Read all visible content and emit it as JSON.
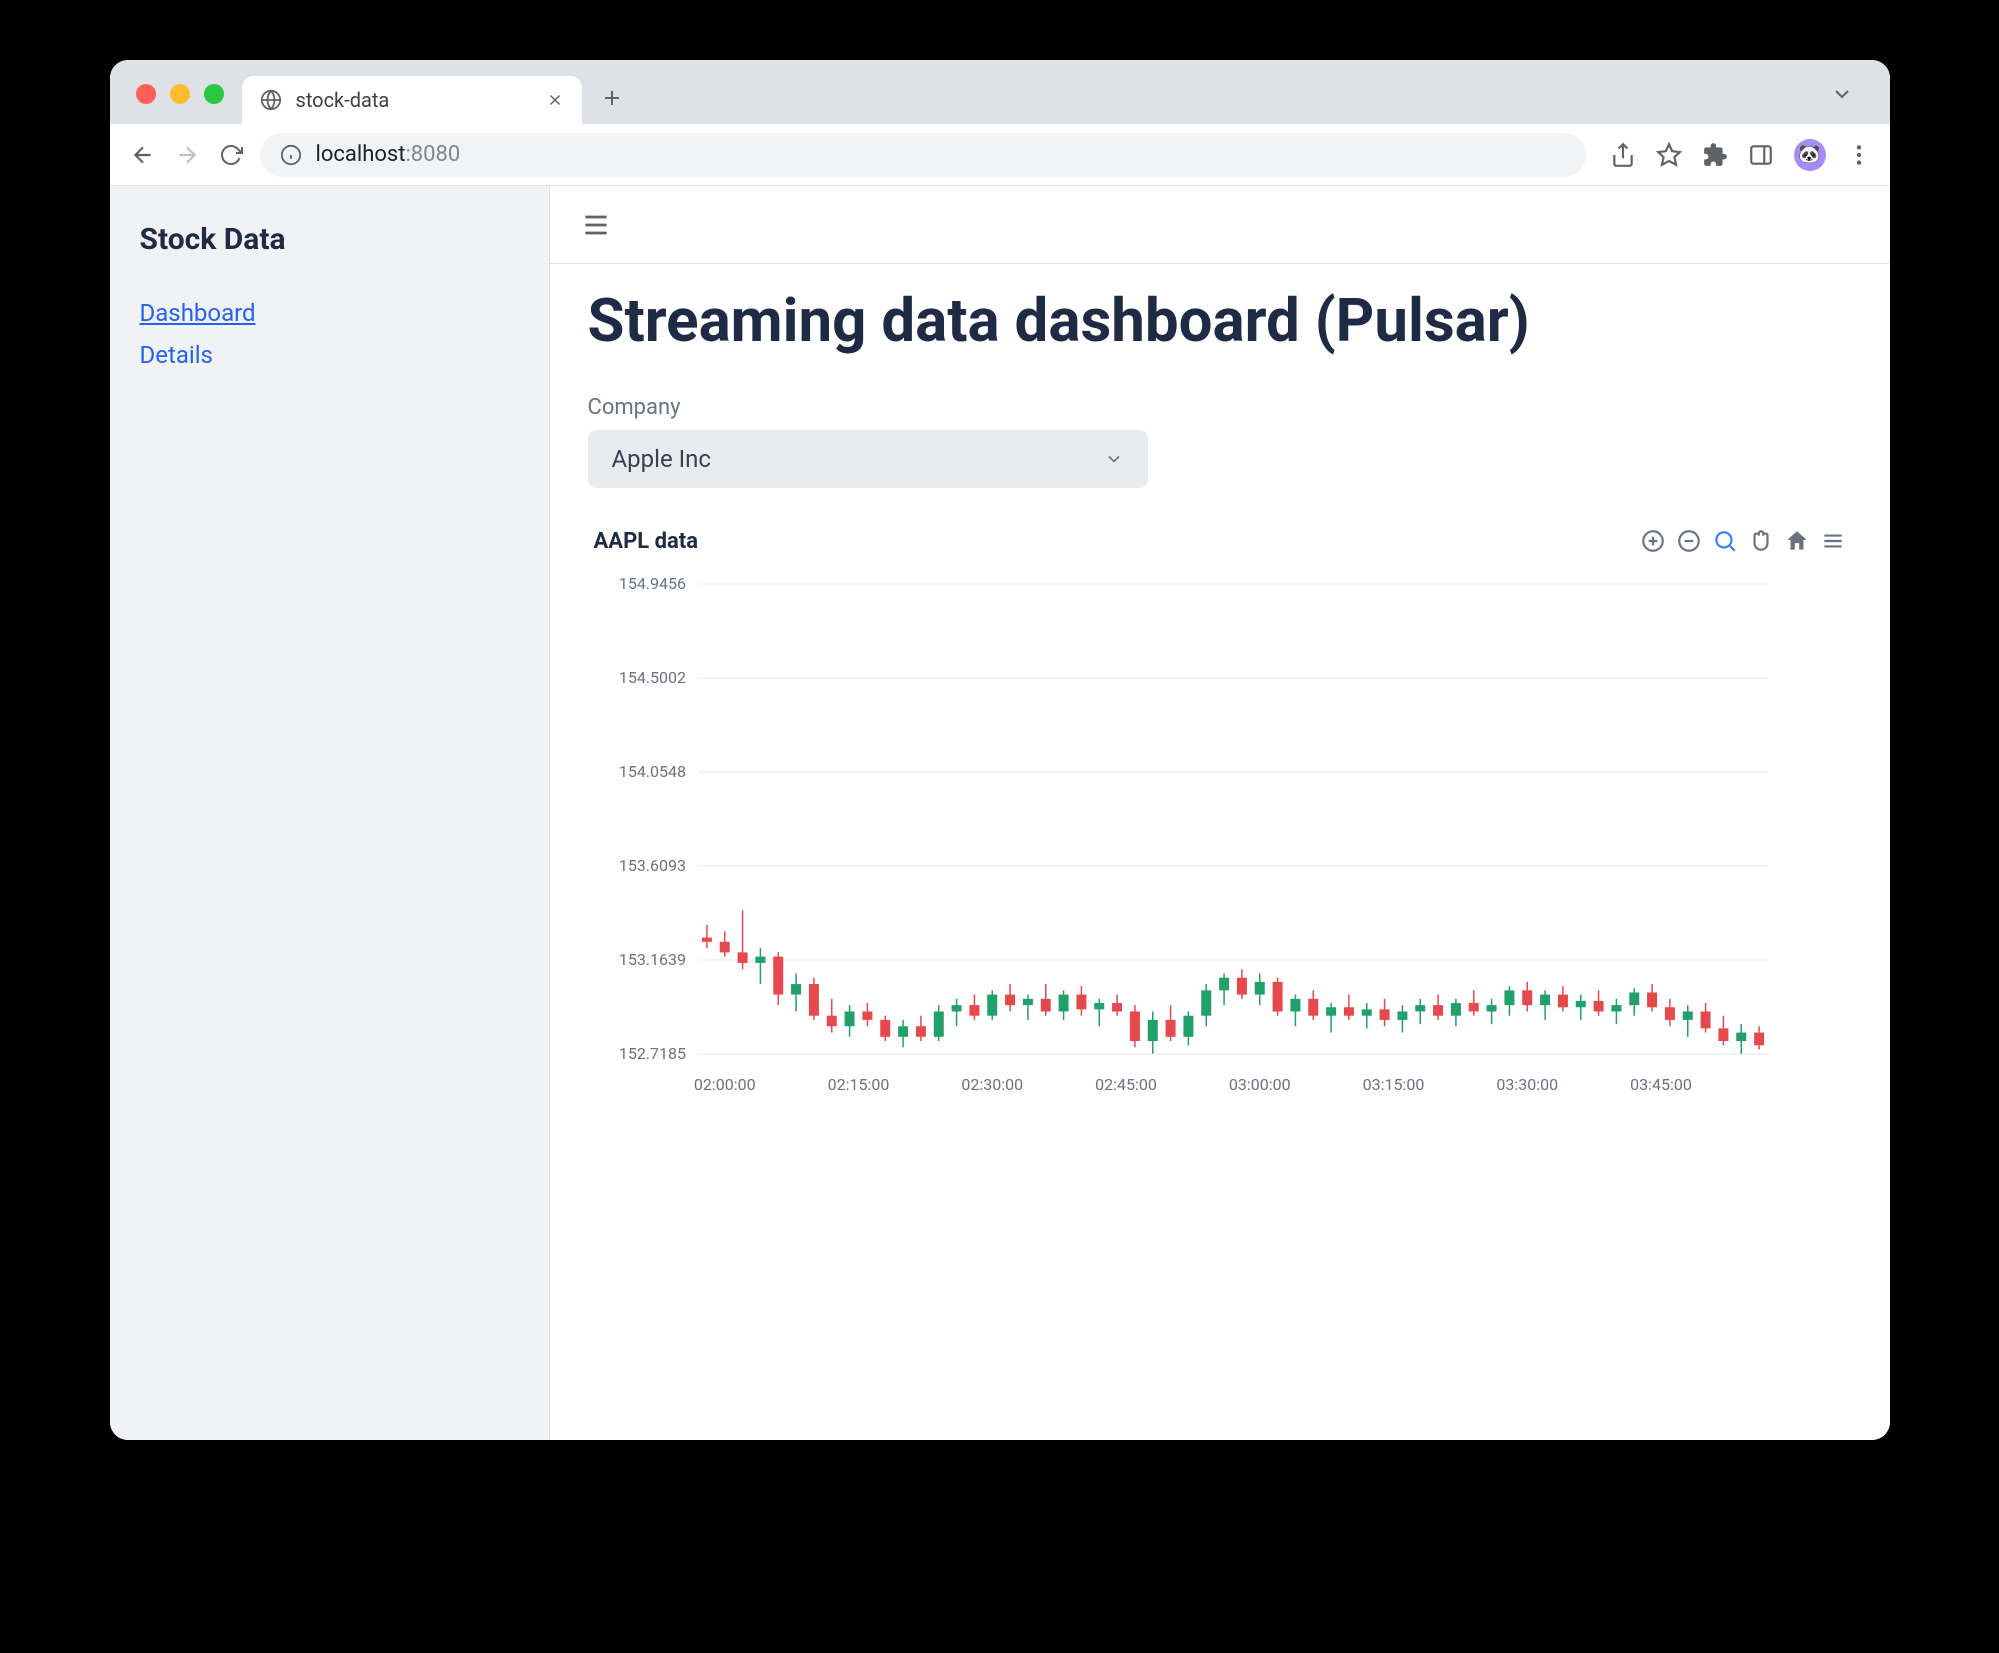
{
  "browser": {
    "tab_title": "stock-data",
    "url_host": "localhost",
    "url_port": ":8080"
  },
  "sidebar": {
    "app_title": "Stock Data",
    "items": [
      {
        "label": "Dashboard",
        "active": true
      },
      {
        "label": "Details",
        "active": false
      }
    ]
  },
  "main": {
    "page_title": "Streaming data dashboard (Pulsar)",
    "company_label": "Company",
    "company_selected": "Apple Inc"
  },
  "chart_data": {
    "type": "candlestick",
    "title": "AAPL data",
    "ylabel": "",
    "xlabel": "",
    "ylim": [
      152.7185,
      154.9456
    ],
    "y_ticks": [
      154.9456,
      154.5002,
      154.0548,
      153.6093,
      153.1639,
      152.7185
    ],
    "x_ticks": [
      "02:00:00",
      "02:15:00",
      "02:30:00",
      "02:45:00",
      "03:00:00",
      "03:15:00",
      "03:30:00",
      "03:45:00"
    ],
    "x_range": [
      "01:57:00",
      "03:57:00"
    ],
    "series": [
      {
        "t": "01:58",
        "o": 153.27,
        "h": 153.33,
        "l": 153.22,
        "c": 153.25
      },
      {
        "t": "02:00",
        "o": 153.25,
        "h": 153.3,
        "l": 153.18,
        "c": 153.2
      },
      {
        "t": "02:02",
        "o": 153.2,
        "h": 153.4,
        "l": 153.12,
        "c": 153.15
      },
      {
        "t": "02:04",
        "o": 153.15,
        "h": 153.22,
        "l": 153.05,
        "c": 153.18
      },
      {
        "t": "02:06",
        "o": 153.18,
        "h": 153.2,
        "l": 152.95,
        "c": 153.0
      },
      {
        "t": "02:08",
        "o": 153.0,
        "h": 153.1,
        "l": 152.92,
        "c": 153.05
      },
      {
        "t": "02:10",
        "o": 153.05,
        "h": 153.08,
        "l": 152.88,
        "c": 152.9
      },
      {
        "t": "02:12",
        "o": 152.9,
        "h": 152.98,
        "l": 152.82,
        "c": 152.85
      },
      {
        "t": "02:14",
        "o": 152.85,
        "h": 152.95,
        "l": 152.8,
        "c": 152.92
      },
      {
        "t": "02:16",
        "o": 152.92,
        "h": 152.96,
        "l": 152.85,
        "c": 152.88
      },
      {
        "t": "02:18",
        "o": 152.88,
        "h": 152.9,
        "l": 152.78,
        "c": 152.8
      },
      {
        "t": "02:20",
        "o": 152.8,
        "h": 152.88,
        "l": 152.75,
        "c": 152.85
      },
      {
        "t": "02:22",
        "o": 152.85,
        "h": 152.9,
        "l": 152.78,
        "c": 152.8
      },
      {
        "t": "02:24",
        "o": 152.8,
        "h": 152.95,
        "l": 152.78,
        "c": 152.92
      },
      {
        "t": "02:26",
        "o": 152.92,
        "h": 152.98,
        "l": 152.85,
        "c": 152.95
      },
      {
        "t": "02:28",
        "o": 152.95,
        "h": 153.0,
        "l": 152.88,
        "c": 152.9
      },
      {
        "t": "02:30",
        "o": 152.9,
        "h": 153.02,
        "l": 152.88,
        "c": 153.0
      },
      {
        "t": "02:32",
        "o": 153.0,
        "h": 153.05,
        "l": 152.92,
        "c": 152.95
      },
      {
        "t": "02:34",
        "o": 152.95,
        "h": 153.0,
        "l": 152.88,
        "c": 152.98
      },
      {
        "t": "02:36",
        "o": 152.98,
        "h": 153.05,
        "l": 152.9,
        "c": 152.92
      },
      {
        "t": "02:38",
        "o": 152.92,
        "h": 153.02,
        "l": 152.88,
        "c": 153.0
      },
      {
        "t": "02:40",
        "o": 153.0,
        "h": 153.04,
        "l": 152.9,
        "c": 152.93
      },
      {
        "t": "02:42",
        "o": 152.93,
        "h": 152.98,
        "l": 152.85,
        "c": 152.96
      },
      {
        "t": "02:44",
        "o": 152.96,
        "h": 153.0,
        "l": 152.9,
        "c": 152.92
      },
      {
        "t": "02:46",
        "o": 152.92,
        "h": 152.95,
        "l": 152.75,
        "c": 152.78
      },
      {
        "t": "02:48",
        "o": 152.78,
        "h": 152.92,
        "l": 152.72,
        "c": 152.88
      },
      {
        "t": "02:50",
        "o": 152.88,
        "h": 152.95,
        "l": 152.78,
        "c": 152.8
      },
      {
        "t": "02:52",
        "o": 152.8,
        "h": 152.92,
        "l": 152.76,
        "c": 152.9
      },
      {
        "t": "02:54",
        "o": 152.9,
        "h": 153.05,
        "l": 152.85,
        "c": 153.02
      },
      {
        "t": "02:56",
        "o": 153.02,
        "h": 153.1,
        "l": 152.95,
        "c": 153.08
      },
      {
        "t": "02:58",
        "o": 153.08,
        "h": 153.12,
        "l": 152.98,
        "c": 153.0
      },
      {
        "t": "03:00",
        "o": 153.0,
        "h": 153.1,
        "l": 152.95,
        "c": 153.06
      },
      {
        "t": "03:02",
        "o": 153.06,
        "h": 153.08,
        "l": 152.9,
        "c": 152.92
      },
      {
        "t": "03:04",
        "o": 152.92,
        "h": 153.0,
        "l": 152.85,
        "c": 152.98
      },
      {
        "t": "03:06",
        "o": 152.98,
        "h": 153.02,
        "l": 152.88,
        "c": 152.9
      },
      {
        "t": "03:08",
        "o": 152.9,
        "h": 152.96,
        "l": 152.82,
        "c": 152.94
      },
      {
        "t": "03:10",
        "o": 152.94,
        "h": 153.0,
        "l": 152.88,
        "c": 152.9
      },
      {
        "t": "03:12",
        "o": 152.9,
        "h": 152.96,
        "l": 152.84,
        "c": 152.93
      },
      {
        "t": "03:14",
        "o": 152.93,
        "h": 152.98,
        "l": 152.85,
        "c": 152.88
      },
      {
        "t": "03:16",
        "o": 152.88,
        "h": 152.95,
        "l": 152.82,
        "c": 152.92
      },
      {
        "t": "03:18",
        "o": 152.92,
        "h": 152.98,
        "l": 152.86,
        "c": 152.95
      },
      {
        "t": "03:20",
        "o": 152.95,
        "h": 153.0,
        "l": 152.88,
        "c": 152.9
      },
      {
        "t": "03:22",
        "o": 152.9,
        "h": 152.98,
        "l": 152.85,
        "c": 152.96
      },
      {
        "t": "03:24",
        "o": 152.96,
        "h": 153.02,
        "l": 152.9,
        "c": 152.92
      },
      {
        "t": "03:26",
        "o": 152.92,
        "h": 152.98,
        "l": 152.86,
        "c": 152.95
      },
      {
        "t": "03:28",
        "o": 152.95,
        "h": 153.04,
        "l": 152.9,
        "c": 153.02
      },
      {
        "t": "03:30",
        "o": 153.02,
        "h": 153.06,
        "l": 152.92,
        "c": 152.95
      },
      {
        "t": "03:32",
        "o": 152.95,
        "h": 153.02,
        "l": 152.88,
        "c": 153.0
      },
      {
        "t": "03:34",
        "o": 153.0,
        "h": 153.04,
        "l": 152.92,
        "c": 152.94
      },
      {
        "t": "03:36",
        "o": 152.94,
        "h": 153.0,
        "l": 152.88,
        "c": 152.97
      },
      {
        "t": "03:38",
        "o": 152.97,
        "h": 153.02,
        "l": 152.9,
        "c": 152.92
      },
      {
        "t": "03:40",
        "o": 152.92,
        "h": 152.98,
        "l": 152.86,
        "c": 152.95
      },
      {
        "t": "03:42",
        "o": 152.95,
        "h": 153.03,
        "l": 152.9,
        "c": 153.01
      },
      {
        "t": "03:44",
        "o": 153.01,
        "h": 153.05,
        "l": 152.92,
        "c": 152.94
      },
      {
        "t": "03:46",
        "o": 152.94,
        "h": 152.98,
        "l": 152.85,
        "c": 152.88
      },
      {
        "t": "03:48",
        "o": 152.88,
        "h": 152.95,
        "l": 152.8,
        "c": 152.92
      },
      {
        "t": "03:50",
        "o": 152.92,
        "h": 152.96,
        "l": 152.82,
        "c": 152.84
      },
      {
        "t": "03:52",
        "o": 152.84,
        "h": 152.9,
        "l": 152.76,
        "c": 152.78
      },
      {
        "t": "03:54",
        "o": 152.78,
        "h": 152.86,
        "l": 152.72,
        "c": 152.82
      },
      {
        "t": "03:56",
        "o": 152.82,
        "h": 152.85,
        "l": 152.74,
        "c": 152.76
      }
    ]
  },
  "chart_toolbar": {
    "zoom_in": "Zoom In",
    "zoom_out": "Zoom Out",
    "zoom": "Zoom",
    "pan": "Pan",
    "reset": "Reset",
    "menu": "Menu"
  }
}
